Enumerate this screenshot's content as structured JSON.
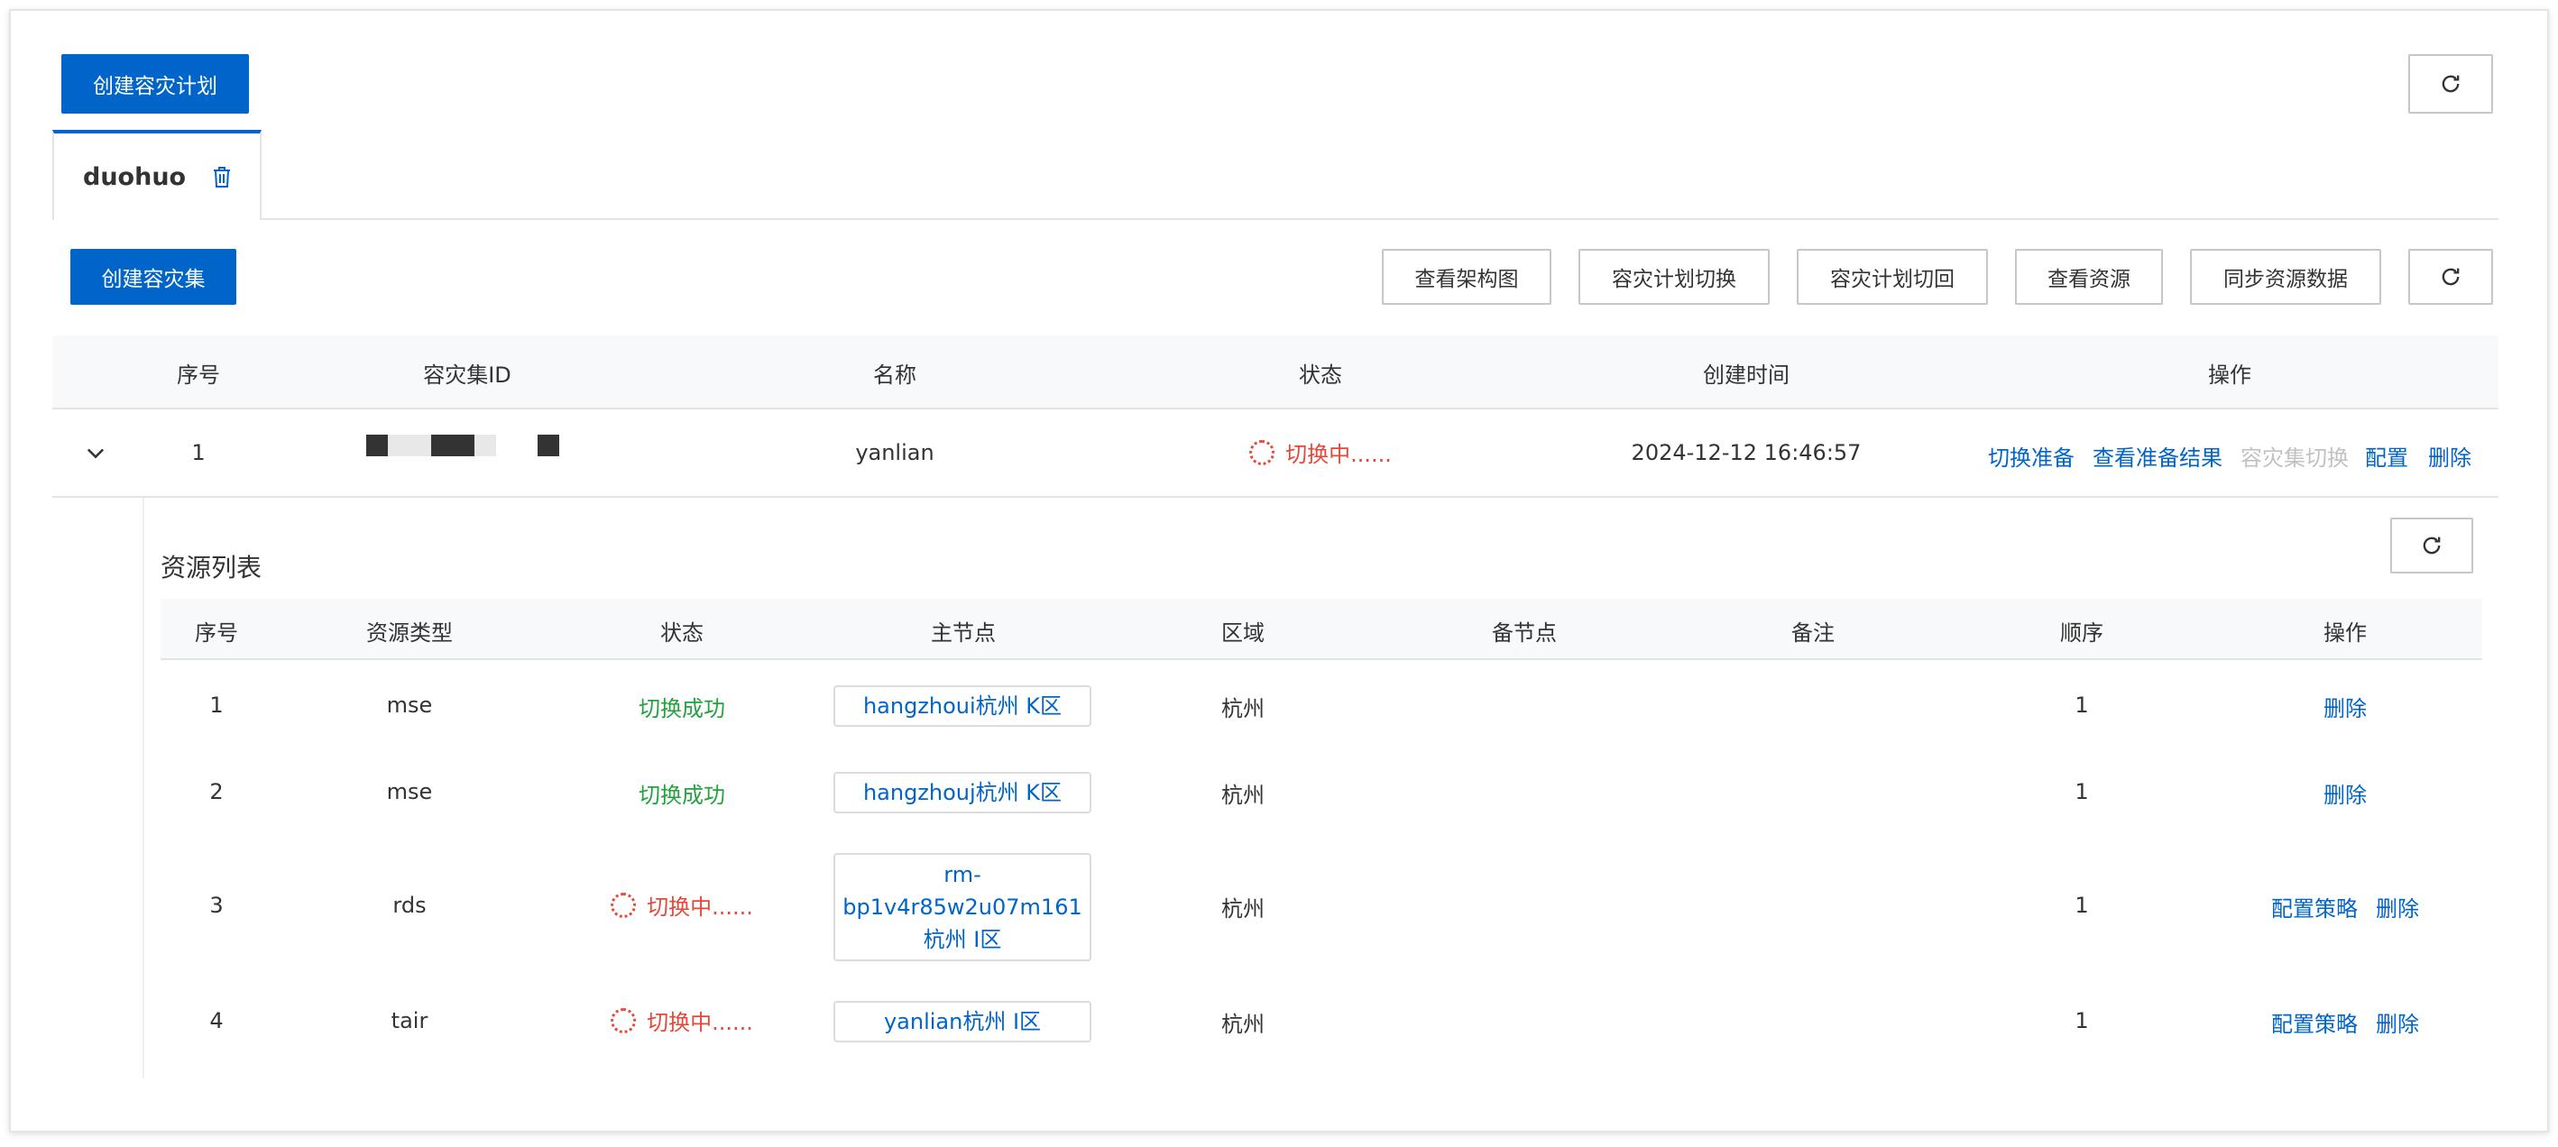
{
  "toolbar": {
    "create_plan_label": "创建容灾计划"
  },
  "plan_tab": {
    "label": "duohuo"
  },
  "plan_actions": {
    "create_set_label": "创建容灾集",
    "view_arch_label": "查看架构图",
    "switch_plan_label": "容灾计划切换",
    "switchback_plan_label": "容灾计划切回",
    "view_resources_label": "查看资源",
    "sync_resources_label": "同步资源数据"
  },
  "set_table": {
    "headers": [
      "序号",
      "容灾集ID",
      "名称",
      "状态",
      "创建时间",
      "操作"
    ],
    "rows": [
      {
        "index": "1",
        "name": "yanlian",
        "status": "切换中......",
        "created": "2024-12-12 16:46:57",
        "actions": [
          "切换准备",
          "查看准备结果",
          "容灾集切换",
          "配置",
          "删除"
        ]
      }
    ]
  },
  "resource_panel": {
    "title": "资源列表",
    "headers": [
      "序号",
      "资源类型",
      "状态",
      "主节点",
      "区域",
      "备节点",
      "备注",
      "顺序",
      "操作"
    ],
    "rows": [
      {
        "index": "1",
        "type": "mse",
        "status": "切换成功",
        "primary": "hangzhoui杭州 K区",
        "region": "杭州",
        "order": "1",
        "actions": [
          "删除"
        ]
      },
      {
        "index": "2",
        "type": "mse",
        "status": "切换成功",
        "primary": "hangzhouj杭州 K区",
        "region": "杭州",
        "order": "1",
        "actions": [
          "删除"
        ]
      },
      {
        "index": "3",
        "type": "rds",
        "status": "切换中......",
        "primary_lines": [
          "rm-",
          "bp1v4r85w2u07m161",
          "杭州 I区"
        ],
        "region": "杭州",
        "order": "1",
        "actions": [
          "配置策略",
          "删除"
        ]
      },
      {
        "index": "4",
        "type": "tair",
        "status": "切换中......",
        "primary": "yanlian杭州 I区",
        "region": "杭州",
        "order": "1",
        "actions": [
          "配置策略",
          "删除"
        ]
      }
    ]
  },
  "colors": {
    "primary": "#0064c8",
    "success": "#23a23e",
    "running": "#e84738",
    "disabled": "#c1c1c1"
  }
}
